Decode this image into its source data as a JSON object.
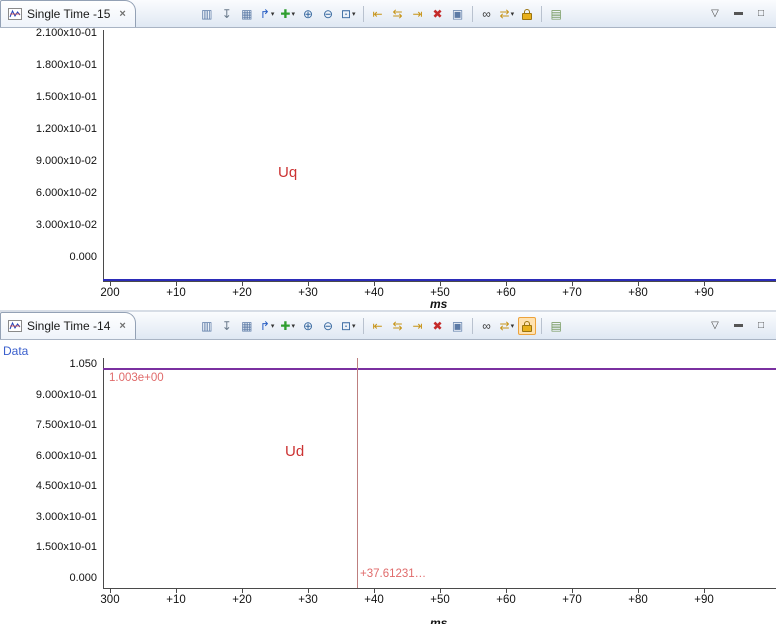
{
  "panels": [
    {
      "tab_title": "Single Time -15"
    },
    {
      "tab_title": "Single Time -14",
      "highlight_icon": "lock-icon"
    }
  ],
  "chrome": {
    "tab_close_glyph": "×",
    "window_controls": [
      {
        "name": "view-menu-icon",
        "glyph": "▽"
      },
      {
        "name": "minimize-icon",
        "glyph": "bar"
      },
      {
        "name": "maximize-icon",
        "glyph": "□"
      }
    ]
  },
  "toolbar": {
    "icons": [
      {
        "name": "fit-waveform-icon",
        "glyph": "▥",
        "color": "#5b7aa6"
      },
      {
        "name": "pin-view-icon",
        "glyph": "↧",
        "color": "#6b7b8c"
      },
      {
        "name": "snap-grid-icon",
        "glyph": "▦",
        "color": "#5b7aa6"
      },
      {
        "name": "cursor-track-icon",
        "glyph": "↱",
        "color": "#2a5fc4",
        "dropdown": true
      },
      {
        "name": "add-signal-icon",
        "glyph": "✚",
        "color": "#2f9e2f",
        "dropdown": true
      },
      {
        "name": "zoom-in-icon",
        "glyph": "⊕",
        "color": "#35679f"
      },
      {
        "name": "zoom-out-icon",
        "glyph": "⊖",
        "color": "#35679f"
      },
      {
        "name": "zoom-selection-icon",
        "glyph": "⊡",
        "color": "#35679f",
        "dropdown": true
      },
      {
        "sep": true
      },
      {
        "name": "marker-prev-icon",
        "glyph": "⇤",
        "color": "#c79418"
      },
      {
        "name": "marker-sync-icon",
        "glyph": "⇆",
        "color": "#c79418"
      },
      {
        "name": "marker-next-icon",
        "glyph": "⇥",
        "color": "#c79418"
      },
      {
        "name": "delete-markers-icon",
        "glyph": "✖",
        "color": "#c42a2a"
      },
      {
        "name": "export-chart-icon",
        "glyph": "▣",
        "color": "#5b7aa6"
      },
      {
        "sep": true
      },
      {
        "name": "search-icon",
        "glyph": "∞",
        "color": "#3a3a3a"
      },
      {
        "name": "compare-traces-icon",
        "glyph": "⇄",
        "color": "#c79418",
        "dropdown": true
      },
      {
        "name": "lock-icon",
        "glyph": "lock",
        "color": "#d8a018"
      },
      {
        "sep": true
      },
      {
        "name": "legend-icon",
        "glyph": "▤",
        "color": "#6f9456"
      }
    ]
  },
  "ui_colors": {
    "annotation_text": "#e06a6a",
    "series_label_text": "#cc3333",
    "cursor_line": "#bd7f7f",
    "legend_text": "#3a5fcd",
    "axis": "#4a4a4a"
  },
  "chart_data": [
    {
      "type": "line",
      "title": "Single Time -15",
      "xlabel": "ms",
      "ylabel": "",
      "grid": false,
      "x_tick_labels": [
        "200",
        "+10",
        "+20",
        "+30",
        "+40",
        "+50",
        "+60",
        "+70",
        "+80",
        "+90"
      ],
      "x_tick_step_ms": 10,
      "x_range_ms": [
        200,
        301
      ],
      "y_tick_labels": [
        "2.100x10-01",
        "1.800x10-01",
        "1.500x10-01",
        "1.200x10-01",
        "9.000x10-02",
        "6.000x10-02",
        "3.000x10-02",
        "0.000"
      ],
      "y_tick_values": [
        0.21,
        0.18,
        0.15,
        0.12,
        0.09,
        0.06,
        0.03,
        0.0
      ],
      "series": [
        {
          "name": "Uq",
          "color": "#2b2bb8",
          "shape": "constant",
          "x_ms": [
            200,
            301
          ],
          "y_approx": [
            -0.02,
            -0.02
          ]
        }
      ]
    },
    {
      "type": "line",
      "title": "Single Time -14",
      "xlabel": "ms",
      "ylabel": "",
      "grid": false,
      "partial_legend_text": "Data",
      "x_tick_labels": [
        "300",
        "+10",
        "+20",
        "+30",
        "+40",
        "+50",
        "+60",
        "+70",
        "+80",
        "+90"
      ],
      "x_tick_step_ms": 10,
      "x_range_ms": [
        300,
        401
      ],
      "y_tick_labels": [
        "1.050",
        "9.000x10-01",
        "7.500x10-01",
        "6.000x10-01",
        "4.500x10-01",
        "3.000x10-01",
        "1.500x10-01",
        "0.000"
      ],
      "y_tick_values": [
        1.05,
        0.9,
        0.75,
        0.6,
        0.45,
        0.3,
        0.15,
        0.0
      ],
      "series": [
        {
          "name": "Ud",
          "color": "#7a30a0",
          "shape": "constant",
          "x_ms": [
            300,
            401
          ],
          "y": [
            1.003,
            1.003
          ],
          "value_label": "1.003e+00"
        }
      ],
      "cursor": {
        "x_offset_label": "+37.61231…",
        "x_offset_ms": 37.61231,
        "color": "#bd7f7f"
      }
    }
  ]
}
